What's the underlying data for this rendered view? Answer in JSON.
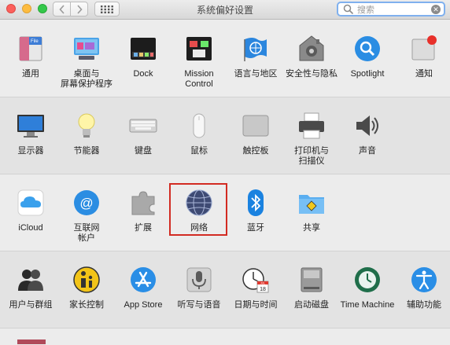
{
  "window": {
    "title": "系统偏好设置"
  },
  "search": {
    "placeholder": "搜索"
  },
  "rows": [
    {
      "panes": [
        {
          "label": "通用",
          "icon": "general-icon"
        },
        {
          "label": "桌面与\n屏幕保护程序",
          "icon": "desktop-screensaver-icon"
        },
        {
          "label": "Dock",
          "icon": "dock-icon"
        },
        {
          "label": "Mission\nControl",
          "icon": "mission-control-icon"
        },
        {
          "label": "语言与地区",
          "icon": "language-region-icon"
        },
        {
          "label": "安全性与隐私",
          "icon": "security-privacy-icon"
        },
        {
          "label": "Spotlight",
          "icon": "spotlight-icon"
        },
        {
          "label": "通知",
          "icon": "notifications-icon"
        }
      ]
    },
    {
      "panes": [
        {
          "label": "显示器",
          "icon": "displays-icon"
        },
        {
          "label": "节能器",
          "icon": "energy-saver-icon"
        },
        {
          "label": "键盘",
          "icon": "keyboard-icon"
        },
        {
          "label": "鼠标",
          "icon": "mouse-icon"
        },
        {
          "label": "触控板",
          "icon": "trackpad-icon"
        },
        {
          "label": "打印机与\n扫描仪",
          "icon": "printers-scanners-icon"
        },
        {
          "label": "声音",
          "icon": "sound-icon"
        }
      ]
    },
    {
      "panes": [
        {
          "label": "iCloud",
          "icon": "icloud-icon"
        },
        {
          "label": "互联网\n帐户",
          "icon": "internet-accounts-icon"
        },
        {
          "label": "扩展",
          "icon": "extensions-icon"
        },
        {
          "label": "网络",
          "icon": "network-icon",
          "selected": true
        },
        {
          "label": "蓝牙",
          "icon": "bluetooth-icon"
        },
        {
          "label": "共享",
          "icon": "sharing-icon"
        }
      ]
    },
    {
      "panes": [
        {
          "label": "用户与群组",
          "icon": "users-groups-icon"
        },
        {
          "label": "家长控制",
          "icon": "parental-controls-icon"
        },
        {
          "label": "App Store",
          "icon": "app-store-icon"
        },
        {
          "label": "听写与语音",
          "icon": "dictation-speech-icon"
        },
        {
          "label": "日期与时间",
          "icon": "date-time-icon"
        },
        {
          "label": "启动磁盘",
          "icon": "startup-disk-icon"
        },
        {
          "label": "Time Machine",
          "icon": "time-machine-icon"
        },
        {
          "label": "辅助功能",
          "icon": "accessibility-icon"
        }
      ]
    }
  ],
  "icon_text": {
    "general": "File\nNew\nOpe",
    "date_month": "JUL",
    "date_day": "18"
  }
}
